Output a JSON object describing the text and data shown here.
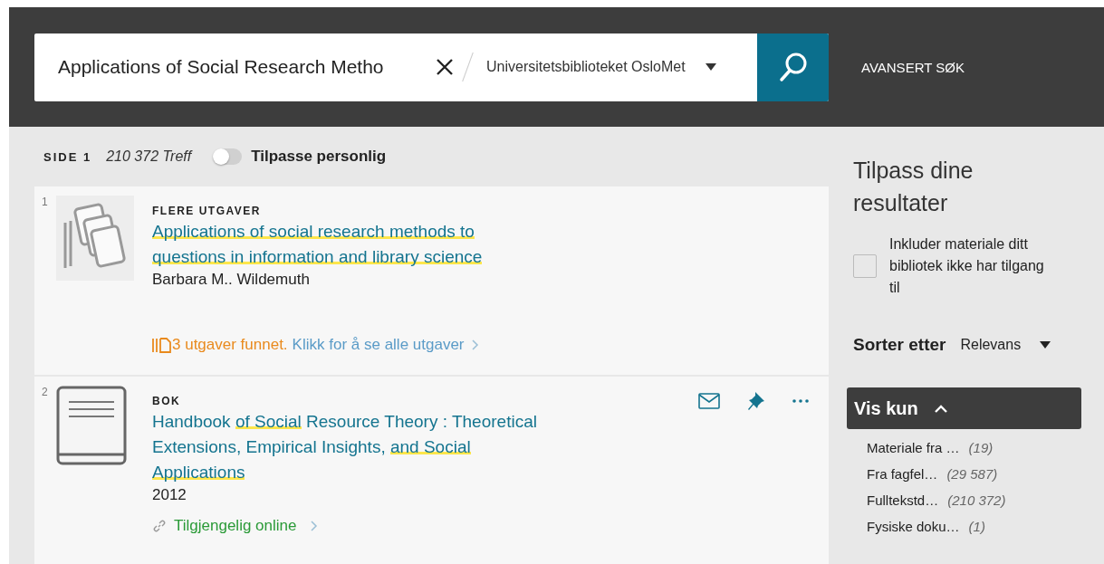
{
  "search": {
    "value": "Applications of Social Research Metho",
    "scope": "Universitetsbiblioteket OsloMet",
    "advanced_link": "AVANSERT SØK"
  },
  "results_bar": {
    "page": "SIDE 1",
    "hits": "210 372 Treff",
    "personalize": {
      "label": "Tilpasse personlig",
      "on": false
    }
  },
  "results": [
    {
      "number": "1",
      "kind": "versions",
      "type": "FLERE UTGAVER",
      "title": [
        {
          "text": "Applications of social research methods to questions in information and library science",
          "highlighted": true
        }
      ],
      "author": "Barbara M.. Wildemuth",
      "versions_found": "3 utgaver funnet.",
      "versions_link": "Klikk for å se alle utgaver"
    },
    {
      "number": "2",
      "kind": "book",
      "type": "BOK",
      "title": [
        {
          "text": "Handbook ",
          "highlighted": false
        },
        {
          "text": "of Social",
          "highlighted": true
        },
        {
          "text": " Resource Theory : Theoretical Extensions, Empirical Insights, ",
          "highlighted": false
        },
        {
          "text": "and Social Applications",
          "highlighted": true
        }
      ],
      "year": "2012",
      "availability": "Tilgjengelig online"
    }
  ],
  "sidebar": {
    "title": "Tilpass dine resultater",
    "include_checkbox": {
      "label": "Inkluder materiale ditt bibliotek ikke har tilgang til",
      "checked": false
    },
    "sort": {
      "label": "Sorter etter",
      "value": "Relevans"
    },
    "filter_section": {
      "title": "Vis kun",
      "expanded": true,
      "items": [
        {
          "label": "Materiale fra …",
          "count": "(19)"
        },
        {
          "label": "Fra fagfel…",
          "count": "(29 587)"
        },
        {
          "label": "Fulltekstd…",
          "count": "(210 372)"
        },
        {
          "label": "Fysiske doku…",
          "count": "(1)"
        }
      ]
    }
  }
}
